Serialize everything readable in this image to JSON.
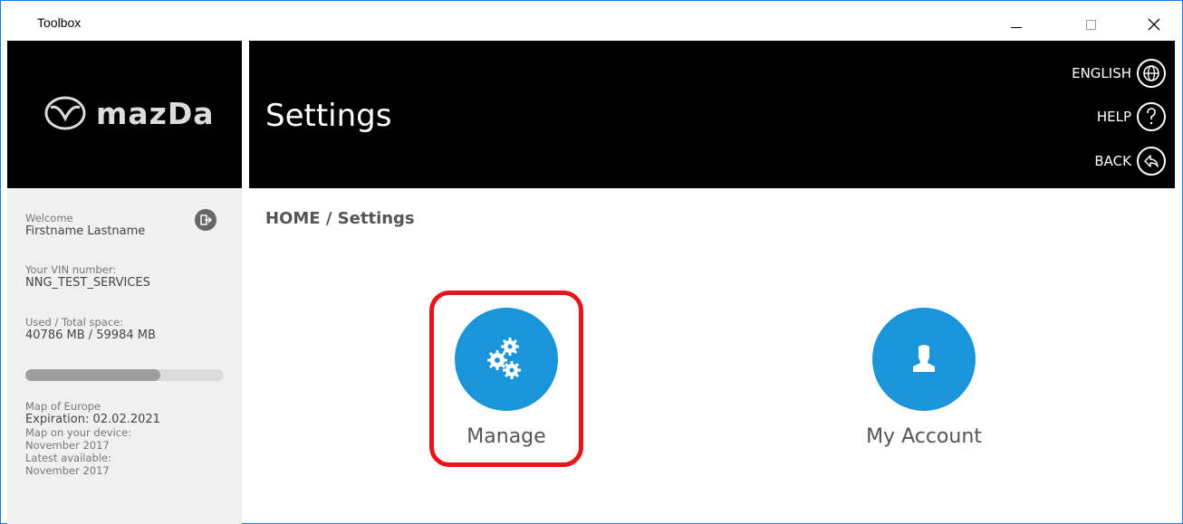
{
  "window": {
    "title": "Toolbox",
    "minimize_icon": "minimize-icon",
    "maximize_icon": "maximize-icon",
    "close_icon": "close-icon"
  },
  "brand": {
    "wordmark": "mazDa",
    "logo_icon": "mazda-logo-icon"
  },
  "header": {
    "title": "Settings",
    "actions": [
      {
        "label": "ENGLISH",
        "icon": "globe-icon"
      },
      {
        "label": "HELP",
        "icon": "question-icon"
      },
      {
        "label": "BACK",
        "icon": "back-arrow-icon"
      }
    ]
  },
  "sidebar": {
    "welcome_label": "Welcome",
    "user_name": "Firstname Lastname",
    "logout_icon": "logout-icon",
    "vin_label": "Your VIN number:",
    "vin_value": "NNG_TEST_SERVICES",
    "space_label": "Used / Total space:",
    "space_value": "40786 MB / 59984 MB",
    "space_used_fraction": 0.68,
    "map_name": "Map of Europe",
    "expiration": "Expiration: 02.02.2021",
    "device_label": "Map on your device:",
    "device_value": "November 2017",
    "latest_label": "Latest available:",
    "latest_value": "November 2017"
  },
  "main": {
    "breadcrumb": "HOME / Settings",
    "tiles": [
      {
        "label": "Manage",
        "icon": "gears-icon",
        "highlighted": true
      },
      {
        "label": "My Account",
        "icon": "user-icon",
        "highlighted": false
      }
    ]
  },
  "colors": {
    "accent": "#1b95d9",
    "highlight": "#e8141b",
    "header_bg": "#000000",
    "sidebar_bg": "#f0f0f0"
  }
}
